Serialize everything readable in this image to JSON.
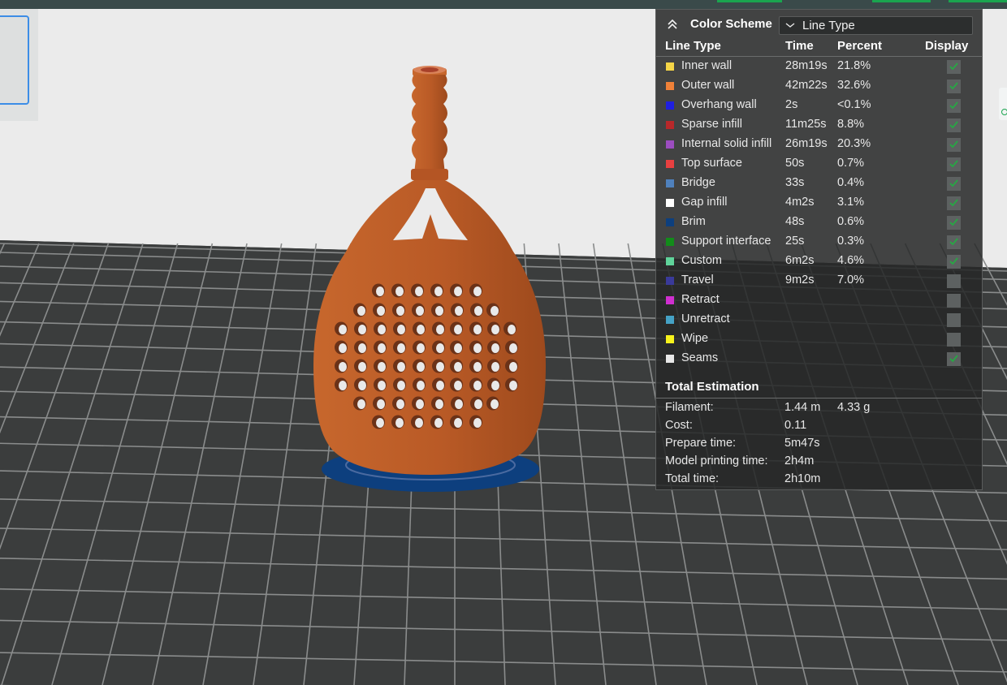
{
  "legend": {
    "scheme_label": "Color Scheme",
    "scheme_value": "Line Type",
    "columns": {
      "line_type": "Line Type",
      "time": "Time",
      "percent": "Percent",
      "display": "Display"
    },
    "rows": [
      {
        "label": "Inner wall",
        "time": "28m19s",
        "percent": "21.8%",
        "color": "#f5d547",
        "checked": true
      },
      {
        "label": "Outer wall",
        "time": "42m22s",
        "percent": "32.6%",
        "color": "#f08138",
        "checked": true
      },
      {
        "label": "Overhang wall",
        "time": "2s",
        "percent": "<0.1%",
        "color": "#1f1fe0",
        "checked": true
      },
      {
        "label": "Sparse infill",
        "time": "11m25s",
        "percent": "8.8%",
        "color": "#b8282a",
        "checked": true
      },
      {
        "label": "Internal solid infill",
        "time": "26m19s",
        "percent": "20.3%",
        "color": "#9c4dc0",
        "checked": true
      },
      {
        "label": "Top surface",
        "time": "50s",
        "percent": "0.7%",
        "color": "#e84040",
        "checked": true
      },
      {
        "label": "Bridge",
        "time": "33s",
        "percent": "0.4%",
        "color": "#4f81bd",
        "checked": true
      },
      {
        "label": "Gap infill",
        "time": "4m2s",
        "percent": "3.1%",
        "color": "#ffffff",
        "checked": true
      },
      {
        "label": "Brim",
        "time": "48s",
        "percent": "0.6%",
        "color": "#0d3f7e",
        "checked": true
      },
      {
        "label": "Support interface",
        "time": "25s",
        "percent": "0.3%",
        "color": "#128c1a",
        "checked": true
      },
      {
        "label": "Custom",
        "time": "6m2s",
        "percent": "4.6%",
        "color": "#5fd39a",
        "checked": true
      },
      {
        "label": "Travel",
        "time": "9m2s",
        "percent": "7.0%",
        "color": "#3a3a9a",
        "checked": false
      },
      {
        "label": "Retract",
        "time": "",
        "percent": "",
        "color": "#d02fd0",
        "checked": false
      },
      {
        "label": "Unretract",
        "time": "",
        "percent": "",
        "color": "#45a2c6",
        "checked": false
      },
      {
        "label": "Wipe",
        "time": "",
        "percent": "",
        "color": "#f7f21c",
        "checked": false
      },
      {
        "label": "Seams",
        "time": "",
        "percent": "",
        "color": "#e8e8e8",
        "checked": true
      }
    ],
    "totals_title": "Total Estimation",
    "totals": [
      {
        "label": "Filament:",
        "v1": "1.44 m",
        "v2": "4.33 g"
      },
      {
        "label": "Cost:",
        "v1": "0.11",
        "v2": ""
      },
      {
        "label": "Prepare time:",
        "v1": "5m47s",
        "v2": ""
      },
      {
        "label": "Model printing time:",
        "v1": "2h4m",
        "v2": ""
      },
      {
        "label": "Total time:",
        "v1": "2h10m",
        "v2": ""
      }
    ]
  },
  "scene": {
    "model_color": "#b95a26",
    "brim_color": "#0d3f7e",
    "support_color": "#128c1a",
    "bed_color": "#3b3d3d",
    "grid_color": "#8a8c8c",
    "backdrop_color": "#ebebeb"
  },
  "icons": {
    "collapse": "double-chevron-up-icon",
    "dropdown": "chevron-down-icon",
    "checkbox": "check-icon"
  }
}
